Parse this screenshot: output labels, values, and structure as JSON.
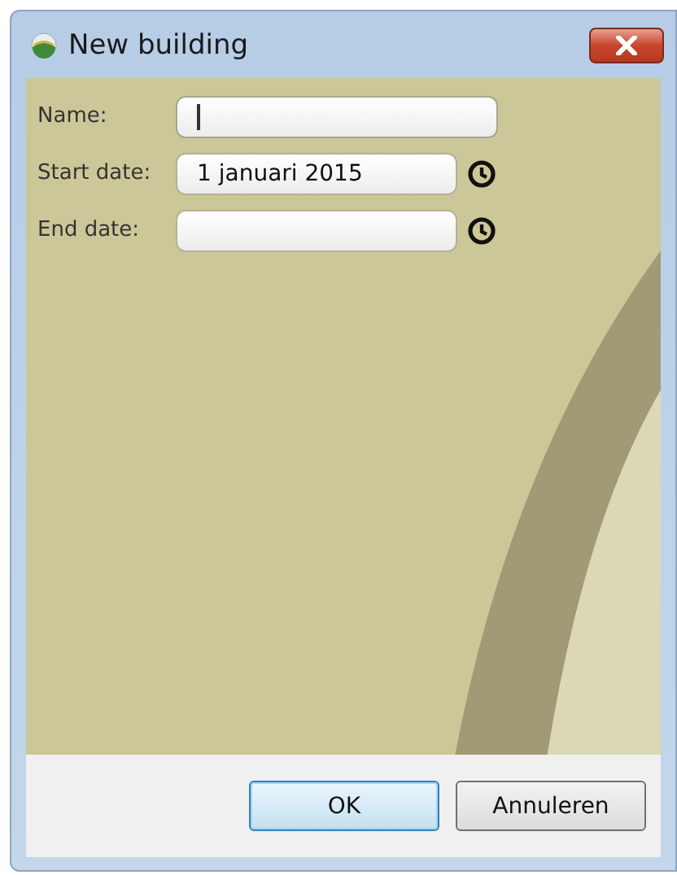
{
  "window": {
    "title": "New building"
  },
  "fields": [
    {
      "kind": "text",
      "label": "Name:",
      "focused": true
    },
    {
      "kind": "date",
      "label": "Start date:",
      "value": "1 januari 2015",
      "focused": false
    },
    {
      "kind": "date",
      "label": "End date:",
      "focused": false
    }
  ],
  "buttons": [
    {
      "label": "OK",
      "default": true
    },
    {
      "label": "Annuleren",
      "default": false
    }
  ]
}
